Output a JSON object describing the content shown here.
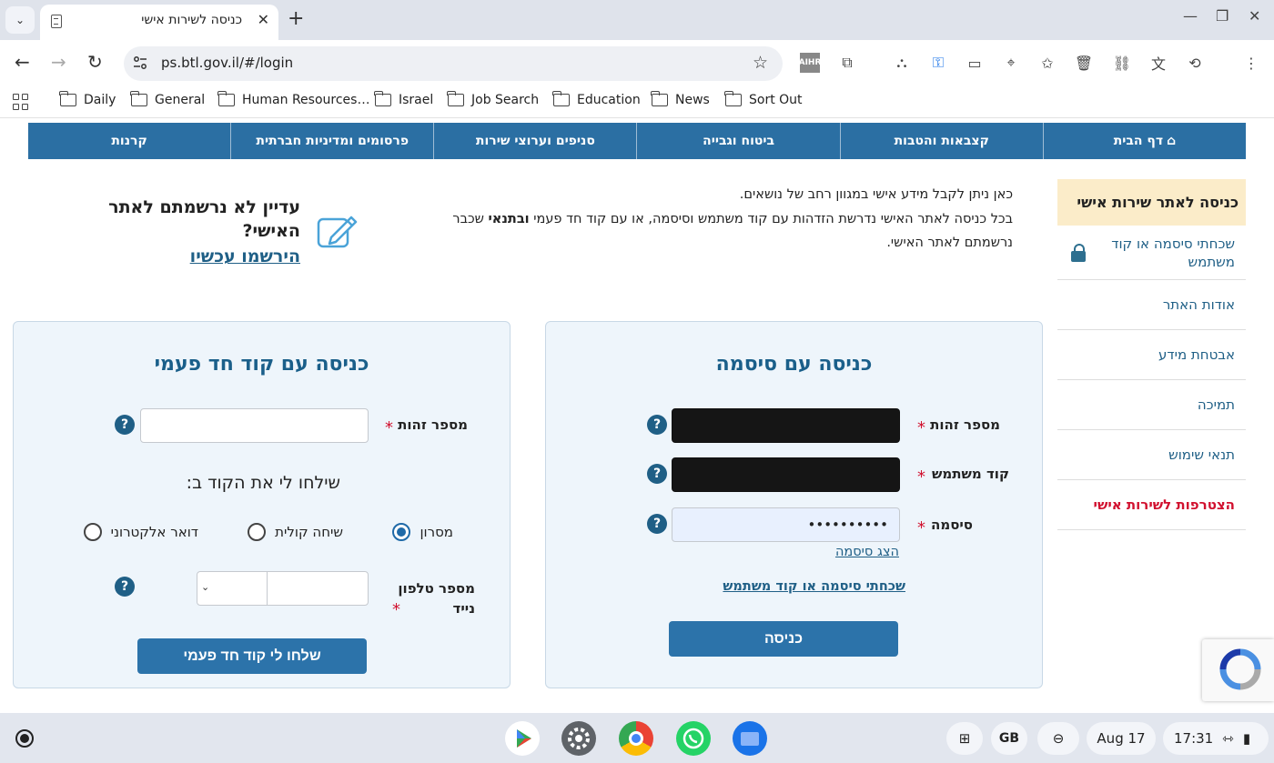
{
  "browser": {
    "tab_title": "כניסה לשירות אישי",
    "tab_close": "✕",
    "new_tab": "+",
    "url": "ps.btl.gov.il/#/login",
    "window_controls": {
      "minimize": "—",
      "restore": "❐",
      "close": "✕"
    }
  },
  "bookmarks": [
    "Daily",
    "General",
    "Human Resources…",
    "Israel",
    "Job Search",
    "Education",
    "News",
    "Sort Out"
  ],
  "main_nav": {
    "home": "דף הבית",
    "items": [
      "קצבאות והטבות",
      "ביטוח וגבייה",
      "סניפים וערוצי שירות",
      "פרסומים ומדיניות חברתית",
      "קרנות"
    ]
  },
  "sidebar": {
    "active": "כניסה לאתר שירות אישי",
    "forgot": "שכחתי סיסמה או קוד משתמש",
    "items": [
      "אודות האתר",
      "אבטחת מידע",
      "תמיכה",
      "תנאי שימוש"
    ],
    "join": "הצטרפות לשירות אישי"
  },
  "intro": {
    "line1": "כאן ניתן לקבל מידע אישי במגוון רחב של נושאים.",
    "line2_pre": "בכל כניסה לאתר האישי נדרשת הזדהות עם קוד משתמש וסיסמה, או עם קוד חד פעמי ",
    "line2_bold": "ובתנאי",
    "line2_post": " שכבר נרשמתם לאתר האישי."
  },
  "register": {
    "title": "עדיין לא נרשמתם לאתר האישי?",
    "link": "הירשמו עכשיו"
  },
  "password_panel": {
    "title": "כניסה עם סיסמה",
    "id_label": "מספר זהות",
    "user_code_label": "קוד משתמש",
    "password_label": "סיסמה",
    "password_value": "••••••••••",
    "show_password": "הצג סיסמה",
    "forgot_link": "שכחתי סיסמה או קוד משתמש",
    "submit": "כניסה"
  },
  "otp_panel": {
    "title": "כניסה עם קוד חד פעמי",
    "id_label": "מספר זהות",
    "send_to_label": "שילחו לי את הקוד ב:",
    "options": [
      "מסרון",
      "שיחה קולית",
      "דואר אלקטרוני"
    ],
    "selected_option": "מסרון",
    "phone_label": "מספר טלפון נייד",
    "submit": "שלחו לי קוד חד פעמי"
  },
  "required_mark": "*",
  "help_mark": "?",
  "shelf": {
    "keyboard": "GB",
    "date": "Aug 17",
    "time": "17:31"
  },
  "colors": {
    "nav_blue": "#2b6fa3",
    "link_blue": "#1f5f86",
    "active_bg": "#fbecc9",
    "panel_bg": "#eef5fb",
    "required_red": "#d1112f"
  }
}
